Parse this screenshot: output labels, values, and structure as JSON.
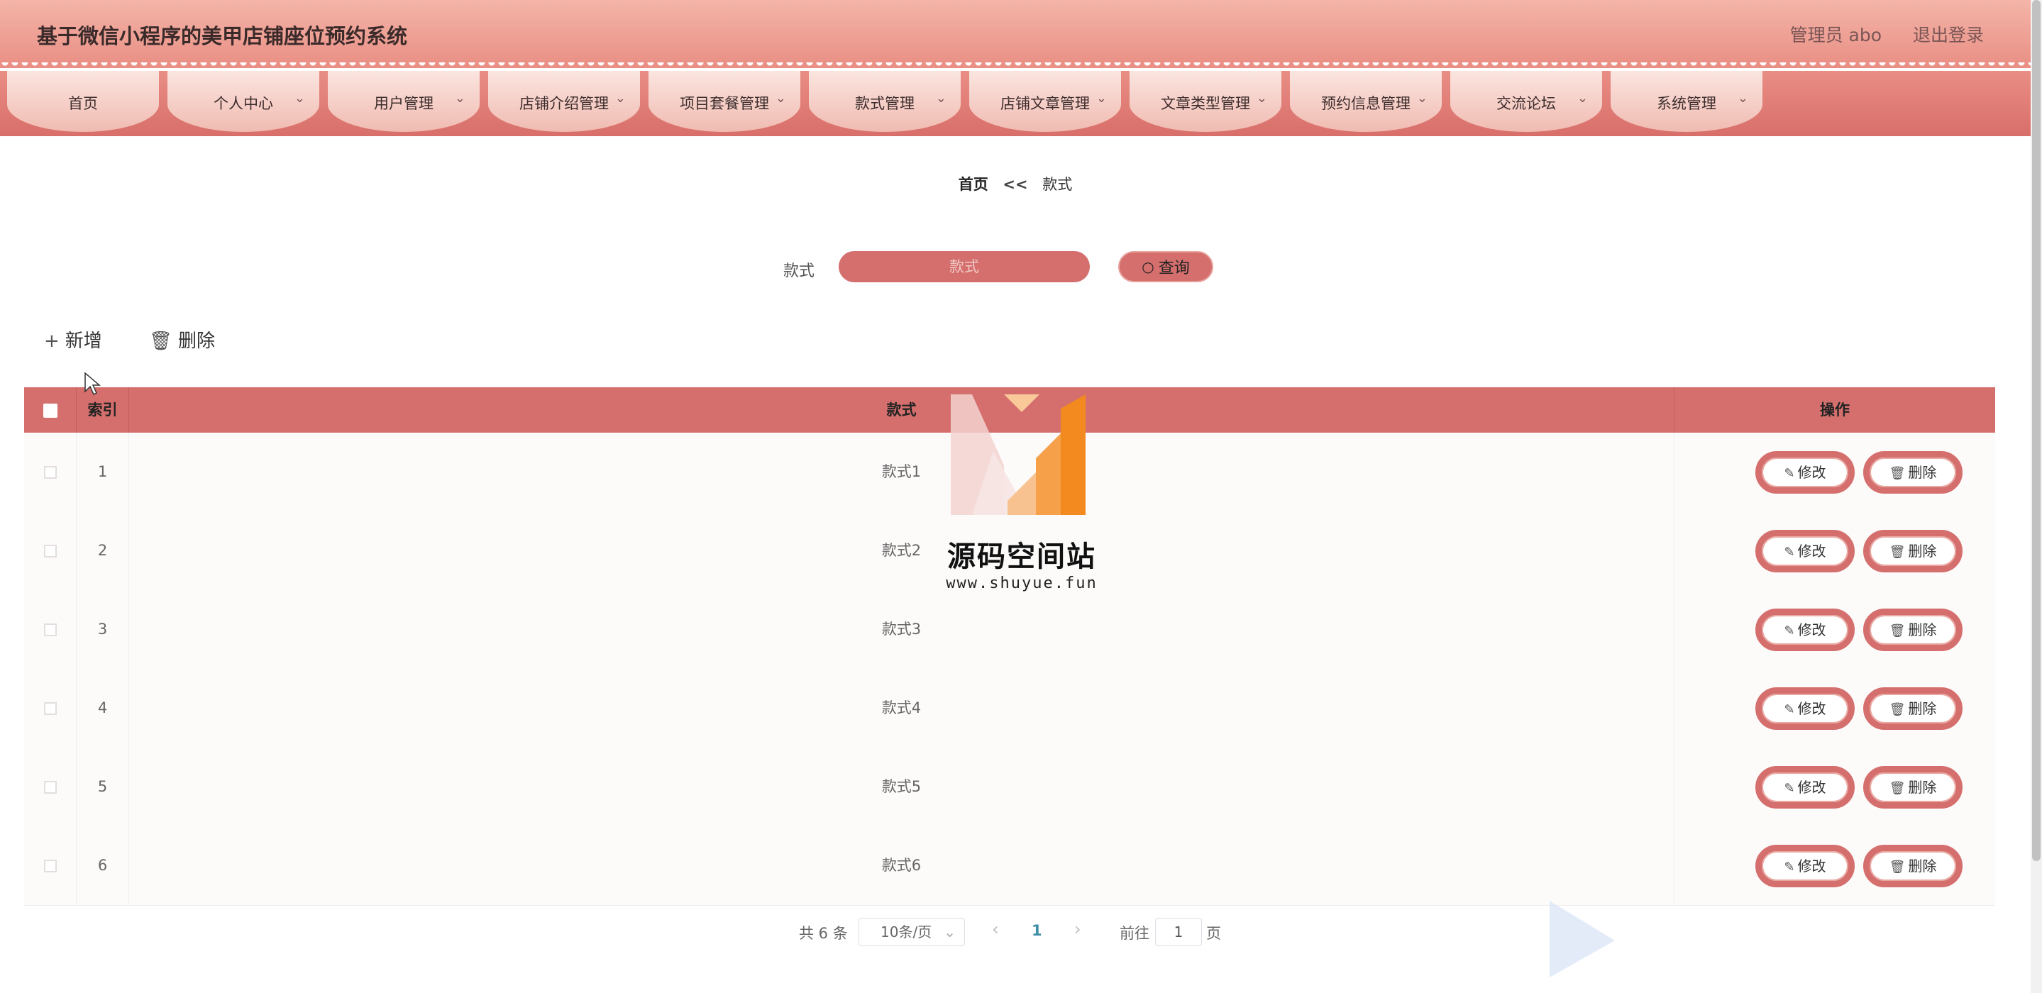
{
  "header": {
    "title": "基于微信小程序的美甲店铺座位预约系统",
    "user": "管理员 abo",
    "logout": "退出登录"
  },
  "nav": {
    "items": [
      {
        "label": "首页",
        "has_dropdown": false
      },
      {
        "label": "个人中心",
        "has_dropdown": true
      },
      {
        "label": "用户管理",
        "has_dropdown": true
      },
      {
        "label": "店铺介绍管理",
        "has_dropdown": true
      },
      {
        "label": "项目套餐管理",
        "has_dropdown": true
      },
      {
        "label": "款式管理",
        "has_dropdown": true
      },
      {
        "label": "店铺文章管理",
        "has_dropdown": true
      },
      {
        "label": "文章类型管理",
        "has_dropdown": true
      },
      {
        "label": "预约信息管理",
        "has_dropdown": true
      },
      {
        "label": "交流论坛",
        "has_dropdown": true
      },
      {
        "label": "系统管理",
        "has_dropdown": true
      }
    ]
  },
  "breadcrumb": {
    "home": "首页",
    "sep": "<<",
    "current": "款式"
  },
  "search": {
    "label": "款式",
    "placeholder": "款式",
    "value": "",
    "button": "查询"
  },
  "toolbar": {
    "add": "新增",
    "delete": "删除"
  },
  "table": {
    "headers": {
      "index": "索引",
      "style": "款式",
      "actions": "操作"
    },
    "rows": [
      {
        "index": "1",
        "style": "款式1"
      },
      {
        "index": "2",
        "style": "款式2"
      },
      {
        "index": "3",
        "style": "款式3"
      },
      {
        "index": "4",
        "style": "款式4"
      },
      {
        "index": "5",
        "style": "款式5"
      },
      {
        "index": "6",
        "style": "款式6"
      }
    ],
    "edit_label": "修改",
    "delete_label": "删除"
  },
  "pagination": {
    "total": "共 6 条",
    "page_size": "10条/页",
    "current_page": "1",
    "goto_prefix": "前往",
    "goto_value": "1",
    "goto_suffix": "页"
  },
  "watermark": {
    "text": "源码空间站",
    "url": "www.shuyue.fun"
  },
  "colors": {
    "accent": "#d46f6e",
    "header_top": "#f4b5a8",
    "link": "#3e8ea8"
  }
}
